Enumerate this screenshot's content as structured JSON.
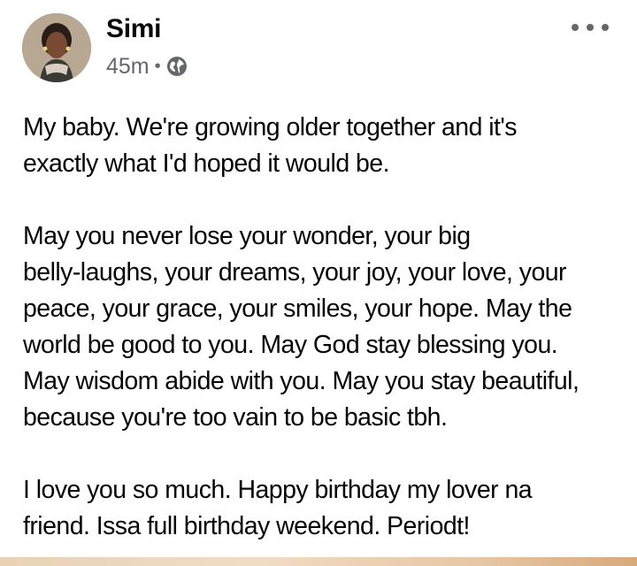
{
  "post": {
    "author": "Simi",
    "time": "45m",
    "separator": "•",
    "privacy_icon": "globe-icon",
    "more_icon": "more-horizontal-icon",
    "paragraphs": [
      [
        "My baby. We're growing older together and it's",
        "exactly what I'd hoped it would be."
      ],
      [
        "May you never lose your wonder, your big",
        "belly-laughs, your dreams, your joy, your love, your",
        "peace, your grace, your smiles, your hope. May the",
        "world be good to you. May God stay blessing you.",
        "May wisdom abide with you. May you stay beautiful,",
        "because you're too vain to be basic tbh."
      ],
      [
        "I love you so much. Happy birthday my lover na",
        "friend. Issa full birthday weekend. Periodt!"
      ]
    ]
  },
  "colors": {
    "text": "#050505",
    "meta": "#65676b",
    "background": "#ffffff"
  }
}
